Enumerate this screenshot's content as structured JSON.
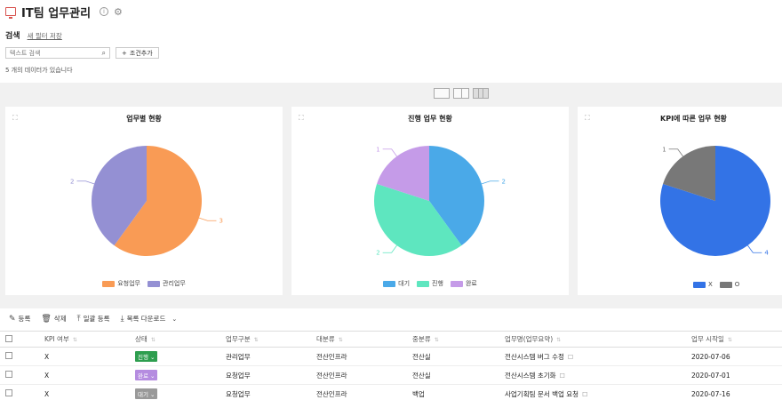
{
  "header": {
    "title": "IT팀 업무관리",
    "info": "i",
    "gear": "⚙"
  },
  "search": {
    "label": "검색",
    "save_filter": "새 필터 저장",
    "placeholder": "텍스트 검색",
    "add_condition": "조건추가",
    "count_text": "5 개의 데이터가 있습니다"
  },
  "charts": [
    {
      "title": "업무별 현황",
      "chart_data": {
        "type": "pie",
        "categories": [
          "요청업무",
          "관리업무"
        ],
        "values": [
          3,
          2
        ],
        "colors": [
          "#f99b55",
          "#9490d3"
        ]
      }
    },
    {
      "title": "진행 업무 현황",
      "chart_data": {
        "type": "pie",
        "categories": [
          "대기",
          "진행",
          "완료"
        ],
        "values": [
          2,
          2,
          1
        ],
        "colors": [
          "#4aa9e8",
          "#5ee6bf",
          "#c59be8"
        ]
      }
    },
    {
      "title": "KPI에 따른 업무 현황",
      "chart_data": {
        "type": "pie",
        "categories": [
          "X",
          "O"
        ],
        "values": [
          4,
          1
        ],
        "colors": [
          "#3373e6",
          "#787878"
        ]
      }
    }
  ],
  "toolbar": {
    "register": "등록",
    "delete": "삭제",
    "bulk": "일괄 등록",
    "download": "목록 다운로드"
  },
  "table": {
    "headers": [
      "KPI 여부",
      "상태",
      "업무구분",
      "대분류",
      "중분류",
      "업무명(업무요약)",
      "업무 시작일"
    ],
    "rows": [
      {
        "kpi": "X",
        "status": "진행",
        "status_color": "#2e9e4f",
        "type": "관리업무",
        "major": "전산인프라",
        "minor": "전산실",
        "name": "전산시스템 버그 수정",
        "date": "2020-07-06"
      },
      {
        "kpi": "X",
        "status": "완료",
        "status_color": "#b58ce0",
        "type": "요청업무",
        "major": "전산인프라",
        "minor": "전산실",
        "name": "전산시스템 초기화",
        "date": "2020-07-01"
      },
      {
        "kpi": "X",
        "status": "대기",
        "status_color": "#999999",
        "type": "요청업무",
        "major": "전산인프라",
        "minor": "백업",
        "name": "사업기획팀 문서 백업 요청",
        "date": "2020-07-16"
      }
    ]
  }
}
